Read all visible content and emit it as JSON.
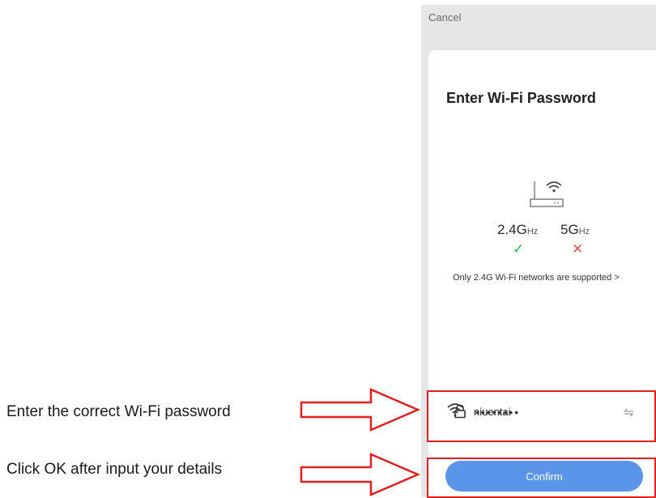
{
  "phone": {
    "cancel_label": "Cancel",
    "title": "Enter Wi-Fi Password",
    "bands": [
      {
        "freq": "2.4G",
        "unit": "Hz",
        "mark": "✓"
      },
      {
        "freq": "5G",
        "unit": "Hz",
        "mark": "✕"
      }
    ],
    "note": "Only 2.4G Wi-Fi networks are supported",
    "note_chevron": ">",
    "network": {
      "ssid": "niuentai"
    },
    "password": {
      "value": "••••••••"
    },
    "confirm_label": "Confirm"
  },
  "annotations": [
    {
      "text": "Enter the correct Wi-Fi password"
    },
    {
      "text": "Click OK after input your details"
    }
  ],
  "colors": {
    "accent": "#5b95ea",
    "highlight_red": "#e51e1e",
    "check_green": "#2cb84a",
    "cross_red": "#e05050"
  },
  "icons": [
    "wifi-router-icon",
    "wifi-icon",
    "switch-network-icon",
    "lock-icon",
    "eye-hidden-icon",
    "check-icon",
    "cross-icon",
    "chevron-right-icon",
    "arrow-right-icon"
  ]
}
